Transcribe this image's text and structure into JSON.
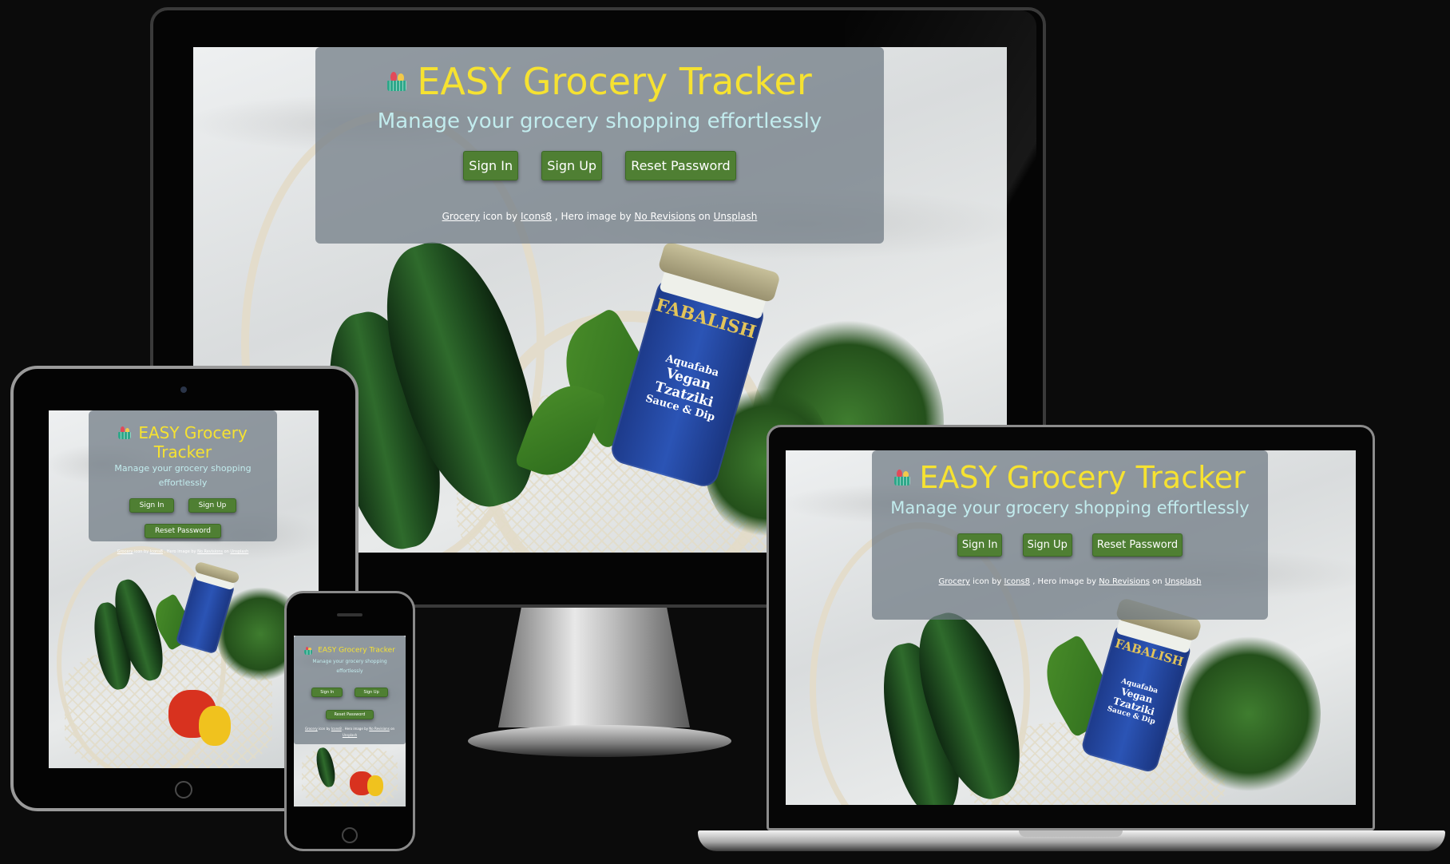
{
  "app": {
    "title": "EASY Grocery Tracker",
    "tagline": "Manage your grocery shopping effortlessly",
    "buttons": {
      "sign_in": "Sign In",
      "sign_up": "Sign Up",
      "reset_password": "Reset Password"
    },
    "credits": {
      "grocery": "Grocery",
      "icon_by": "icon by",
      "icons8": "Icons8",
      "hero_by": ", Hero image by",
      "no_revisions": "No Revisions",
      "on": "on",
      "unsplash": "Unsplash"
    },
    "jar": {
      "brand": "FABALISH",
      "line1": "Aquafaba",
      "line2": "Vegan Tzatziki",
      "line3": "Sauce & Dip"
    }
  },
  "icons": {
    "logo": "grocery-basket-icon"
  },
  "colors": {
    "background": "#0b0b0b",
    "title": "#f6e231",
    "tagline": "#c2ecee",
    "button": "#4f7f33",
    "card": "rgba(110,120,130,0.72)"
  }
}
